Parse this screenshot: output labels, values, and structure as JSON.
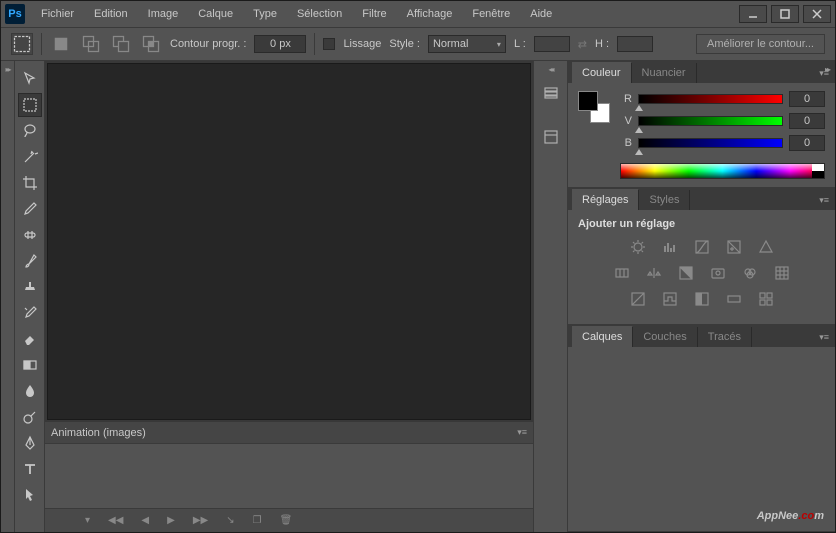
{
  "app": {
    "logo": "Ps"
  },
  "menu": [
    "Fichier",
    "Edition",
    "Image",
    "Calque",
    "Type",
    "Sélection",
    "Filtre",
    "Affichage",
    "Fenêtre",
    "Aide"
  ],
  "optbar": {
    "contour_label": "Contour progr. :",
    "contour_value": "0 px",
    "lissage": "Lissage",
    "style_label": "Style :",
    "style_value": "Normal",
    "l_label": "L :",
    "h_label": "H :",
    "refine": "Améliorer le contour..."
  },
  "animation": {
    "title": "Animation (images)"
  },
  "panels": {
    "color": {
      "tabs": [
        "Couleur",
        "Nuancier"
      ],
      "channels": [
        {
          "label": "R",
          "value": "0"
        },
        {
          "label": "V",
          "value": "0"
        },
        {
          "label": "B",
          "value": "0"
        }
      ]
    },
    "adjust": {
      "tabs": [
        "Réglages",
        "Styles"
      ],
      "title": "Ajouter un réglage"
    },
    "layers": {
      "tabs": [
        "Calques",
        "Couches",
        "Tracés"
      ]
    }
  },
  "watermark": {
    "a": "AppNee",
    "dot": ".c",
    "om": "m"
  }
}
